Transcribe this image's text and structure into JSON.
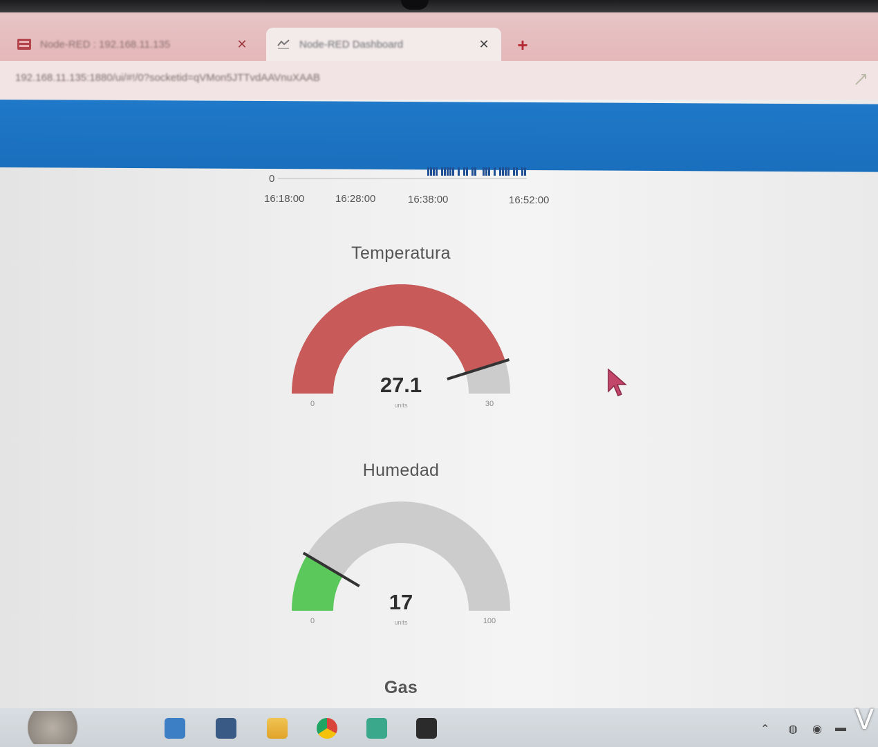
{
  "browser": {
    "tabs": [
      {
        "title": "Node-RED : 192.168.11.135",
        "active": false,
        "favicon": "node-red-icon"
      },
      {
        "title": "Node-RED Dashboard",
        "active": true,
        "favicon": "dashboard-icon"
      }
    ],
    "new_tab": "+",
    "close_glyph": "✕",
    "url": "192.168.11.135:1880/ui/#!/0?socketid=qVMon5JTTvdAAVnuXAAB"
  },
  "chart": {
    "y_tick": "0",
    "x_ticks": [
      "16:18:00",
      "16:28:00",
      "16:38:00",
      "16:52:00"
    ]
  },
  "gauges": [
    {
      "title": "Temperatura",
      "value": 27.1,
      "display": "27.1",
      "min": 0,
      "max": 30,
      "min_label": "0",
      "max_label": "30",
      "unit": "units",
      "fill_color": "#c85a5a"
    },
    {
      "title": "Humedad",
      "value": 17,
      "display": "17",
      "min": 0,
      "max": 100,
      "min_label": "0",
      "max_label": "100",
      "unit": "units",
      "fill_color": "#5ac85a"
    },
    {
      "title": "Gas"
    }
  ],
  "colors": {
    "appbar": "#1f78c8",
    "gauge_track": "#cccccc",
    "needle": "#333333"
  },
  "taskbar": {
    "icons": [
      "file-explorer-icon",
      "store-icon",
      "folder-icon",
      "chrome-icon",
      "maps-icon",
      "terminal-icon"
    ],
    "watermark": "V"
  }
}
